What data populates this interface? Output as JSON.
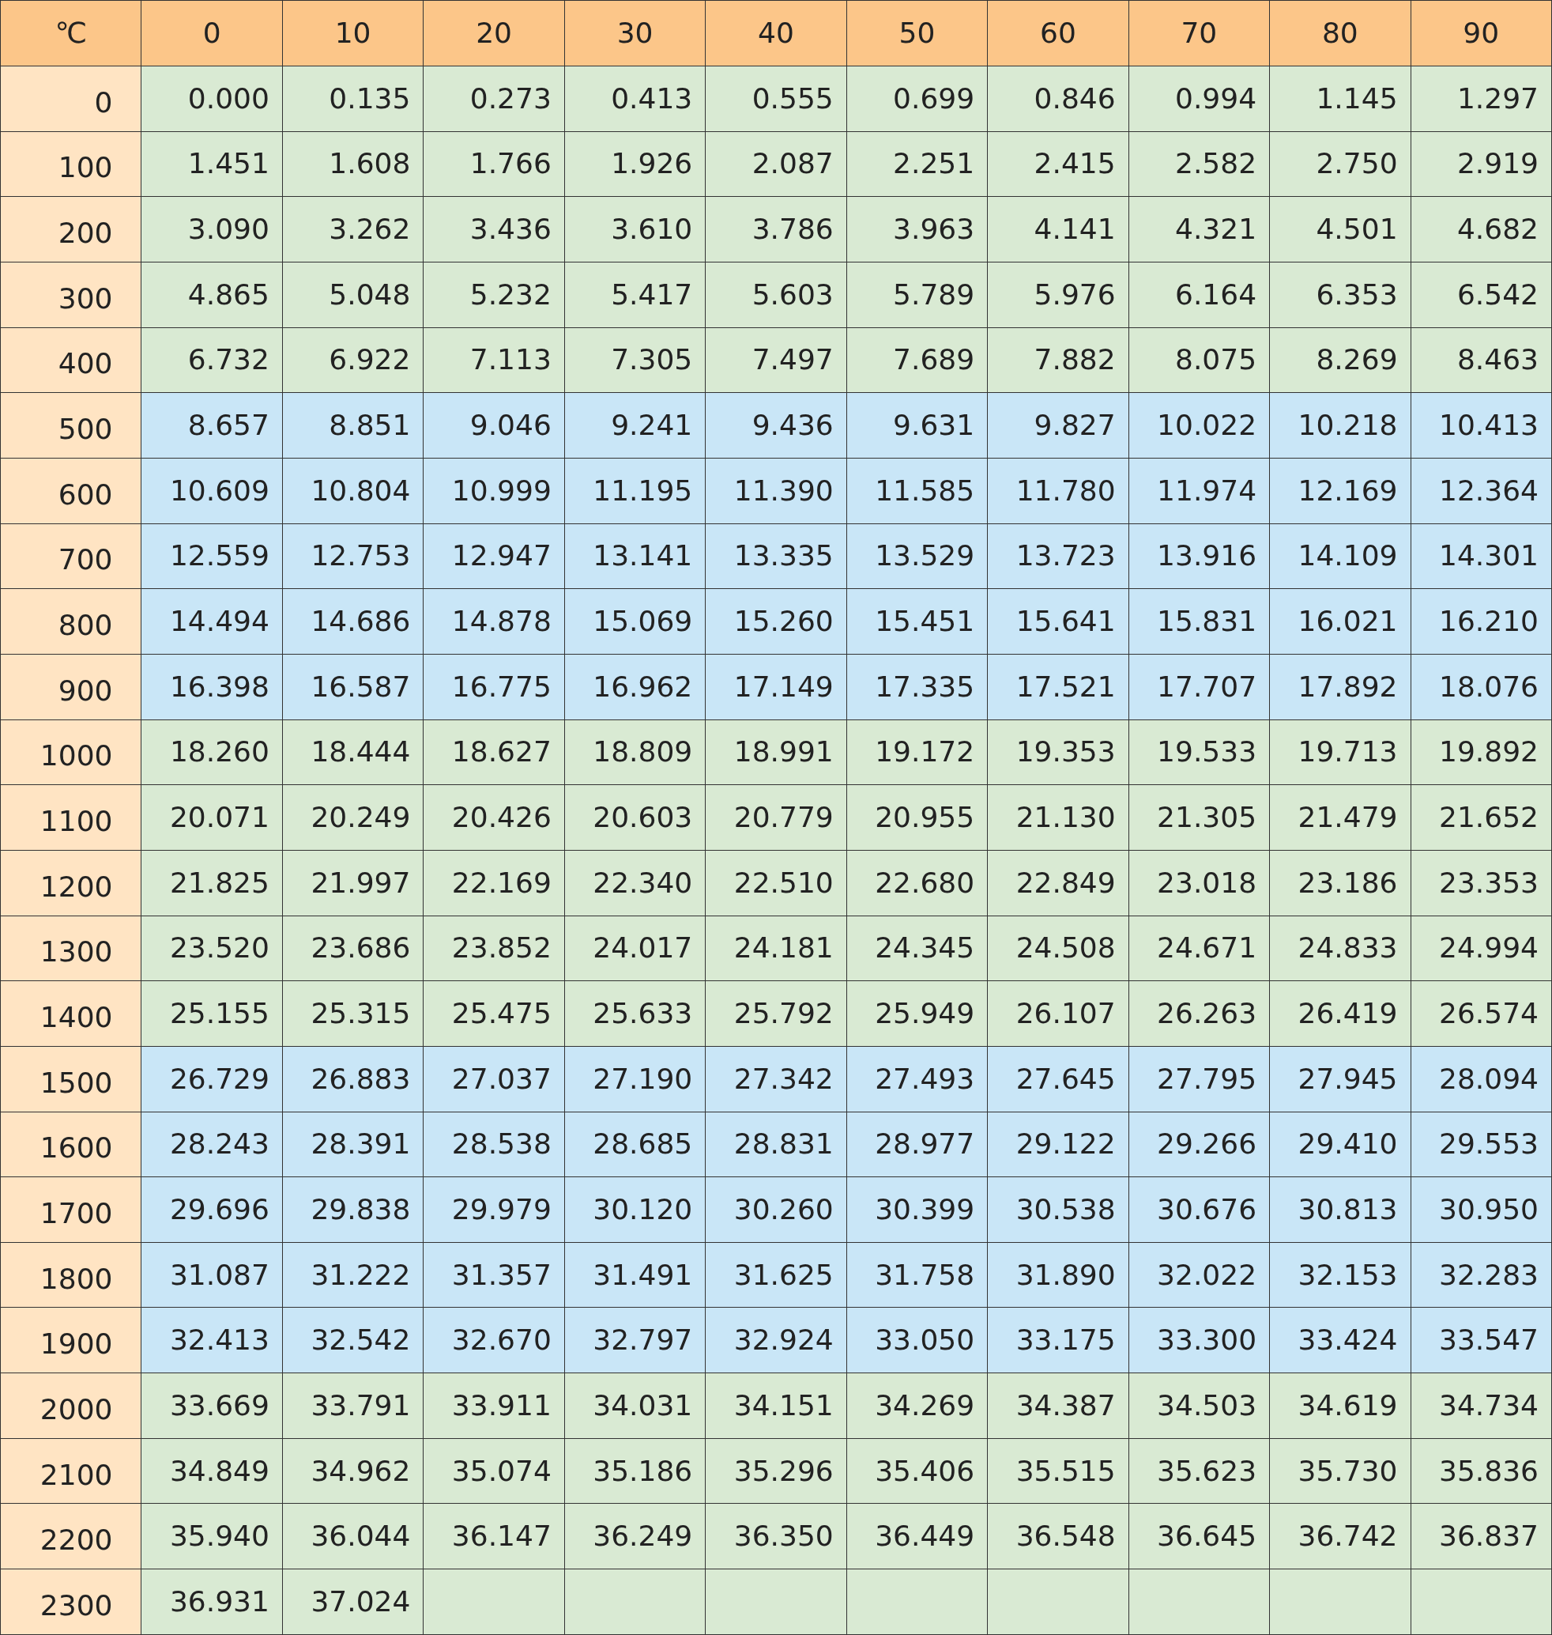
{
  "table": {
    "corner": "℃",
    "columns": [
      "0",
      "10",
      "20",
      "30",
      "40",
      "50",
      "60",
      "70",
      "80",
      "90"
    ],
    "rows": [
      {
        "label": "0",
        "color": "#d9ead3",
        "values": [
          "0.000",
          "0.135",
          "0.273",
          "0.413",
          "0.555",
          "0.699",
          "0.846",
          "0.994",
          "1.145",
          "1.297"
        ]
      },
      {
        "label": "100",
        "color": "#d9ead3",
        "values": [
          "1.451",
          "1.608",
          "1.766",
          "1.926",
          "2.087",
          "2.251",
          "2.415",
          "2.582",
          "2.750",
          "2.919"
        ]
      },
      {
        "label": "200",
        "color": "#d9ead3",
        "values": [
          "3.090",
          "3.262",
          "3.436",
          "3.610",
          "3.786",
          "3.963",
          "4.141",
          "4.321",
          "4.501",
          "4.682"
        ]
      },
      {
        "label": "300",
        "color": "#d9ead3",
        "values": [
          "4.865",
          "5.048",
          "5.232",
          "5.417",
          "5.603",
          "5.789",
          "5.976",
          "6.164",
          "6.353",
          "6.542"
        ]
      },
      {
        "label": "400",
        "color": "#d9ead3",
        "values": [
          "6.732",
          "6.922",
          "7.113",
          "7.305",
          "7.497",
          "7.689",
          "7.882",
          "8.075",
          "8.269",
          "8.463"
        ]
      },
      {
        "label": "500",
        "color": "#c9e6f7",
        "values": [
          "8.657",
          "8.851",
          "9.046",
          "9.241",
          "9.436",
          "9.631",
          "9.827",
          "10.022",
          "10.218",
          "10.413"
        ]
      },
      {
        "label": "600",
        "color": "#c9e6f7",
        "values": [
          "10.609",
          "10.804",
          "10.999",
          "11.195",
          "11.390",
          "11.585",
          "11.780",
          "11.974",
          "12.169",
          "12.364"
        ]
      },
      {
        "label": "700",
        "color": "#c9e6f7",
        "values": [
          "12.559",
          "12.753",
          "12.947",
          "13.141",
          "13.335",
          "13.529",
          "13.723",
          "13.916",
          "14.109",
          "14.301"
        ]
      },
      {
        "label": "800",
        "color": "#c9e6f7",
        "values": [
          "14.494",
          "14.686",
          "14.878",
          "15.069",
          "15.260",
          "15.451",
          "15.641",
          "15.831",
          "16.021",
          "16.210"
        ]
      },
      {
        "label": "900",
        "color": "#c9e6f7",
        "values": [
          "16.398",
          "16.587",
          "16.775",
          "16.962",
          "17.149",
          "17.335",
          "17.521",
          "17.707",
          "17.892",
          "18.076"
        ]
      },
      {
        "label": "1000",
        "color": "#d9ead3",
        "values": [
          "18.260",
          "18.444",
          "18.627",
          "18.809",
          "18.991",
          "19.172",
          "19.353",
          "19.533",
          "19.713",
          "19.892"
        ]
      },
      {
        "label": "1100",
        "color": "#d9ead3",
        "values": [
          "20.071",
          "20.249",
          "20.426",
          "20.603",
          "20.779",
          "20.955",
          "21.130",
          "21.305",
          "21.479",
          "21.652"
        ]
      },
      {
        "label": "1200",
        "color": "#d9ead3",
        "values": [
          "21.825",
          "21.997",
          "22.169",
          "22.340",
          "22.510",
          "22.680",
          "22.849",
          "23.018",
          "23.186",
          "23.353"
        ]
      },
      {
        "label": "1300",
        "color": "#d9ead3",
        "values": [
          "23.520",
          "23.686",
          "23.852",
          "24.017",
          "24.181",
          "24.345",
          "24.508",
          "24.671",
          "24.833",
          "24.994"
        ]
      },
      {
        "label": "1400",
        "color": "#d9ead3",
        "values": [
          "25.155",
          "25.315",
          "25.475",
          "25.633",
          "25.792",
          "25.949",
          "26.107",
          "26.263",
          "26.419",
          "26.574"
        ]
      },
      {
        "label": "1500",
        "color": "#c9e6f7",
        "values": [
          "26.729",
          "26.883",
          "27.037",
          "27.190",
          "27.342",
          "27.493",
          "27.645",
          "27.795",
          "27.945",
          "28.094"
        ]
      },
      {
        "label": "1600",
        "color": "#c9e6f7",
        "values": [
          "28.243",
          "28.391",
          "28.538",
          "28.685",
          "28.831",
          "28.977",
          "29.122",
          "29.266",
          "29.410",
          "29.553"
        ]
      },
      {
        "label": "1700",
        "color": "#c9e6f7",
        "values": [
          "29.696",
          "29.838",
          "29.979",
          "30.120",
          "30.260",
          "30.399",
          "30.538",
          "30.676",
          "30.813",
          "30.950"
        ]
      },
      {
        "label": "1800",
        "color": "#c9e6f7",
        "values": [
          "31.087",
          "31.222",
          "31.357",
          "31.491",
          "31.625",
          "31.758",
          "31.890",
          "32.022",
          "32.153",
          "32.283"
        ]
      },
      {
        "label": "1900",
        "color": "#c9e6f7",
        "values": [
          "32.413",
          "32.542",
          "32.670",
          "32.797",
          "32.924",
          "33.050",
          "33.175",
          "33.300",
          "33.424",
          "33.547"
        ]
      },
      {
        "label": "2000",
        "color": "#d9ead3",
        "values": [
          "33.669",
          "33.791",
          "33.911",
          "34.031",
          "34.151",
          "34.269",
          "34.387",
          "34.503",
          "34.619",
          "34.734"
        ]
      },
      {
        "label": "2100",
        "color": "#d9ead3",
        "values": [
          "34.849",
          "34.962",
          "35.074",
          "35.186",
          "35.296",
          "35.406",
          "35.515",
          "35.623",
          "35.730",
          "35.836"
        ]
      },
      {
        "label": "2200",
        "color": "#d9ead3",
        "values": [
          "35.940",
          "36.044",
          "36.147",
          "36.249",
          "36.350",
          "36.449",
          "36.548",
          "36.645",
          "36.742",
          "36.837"
        ]
      },
      {
        "label": "2300",
        "color": "#d9ead3",
        "values": [
          "36.931",
          "37.024"
        ]
      }
    ]
  }
}
